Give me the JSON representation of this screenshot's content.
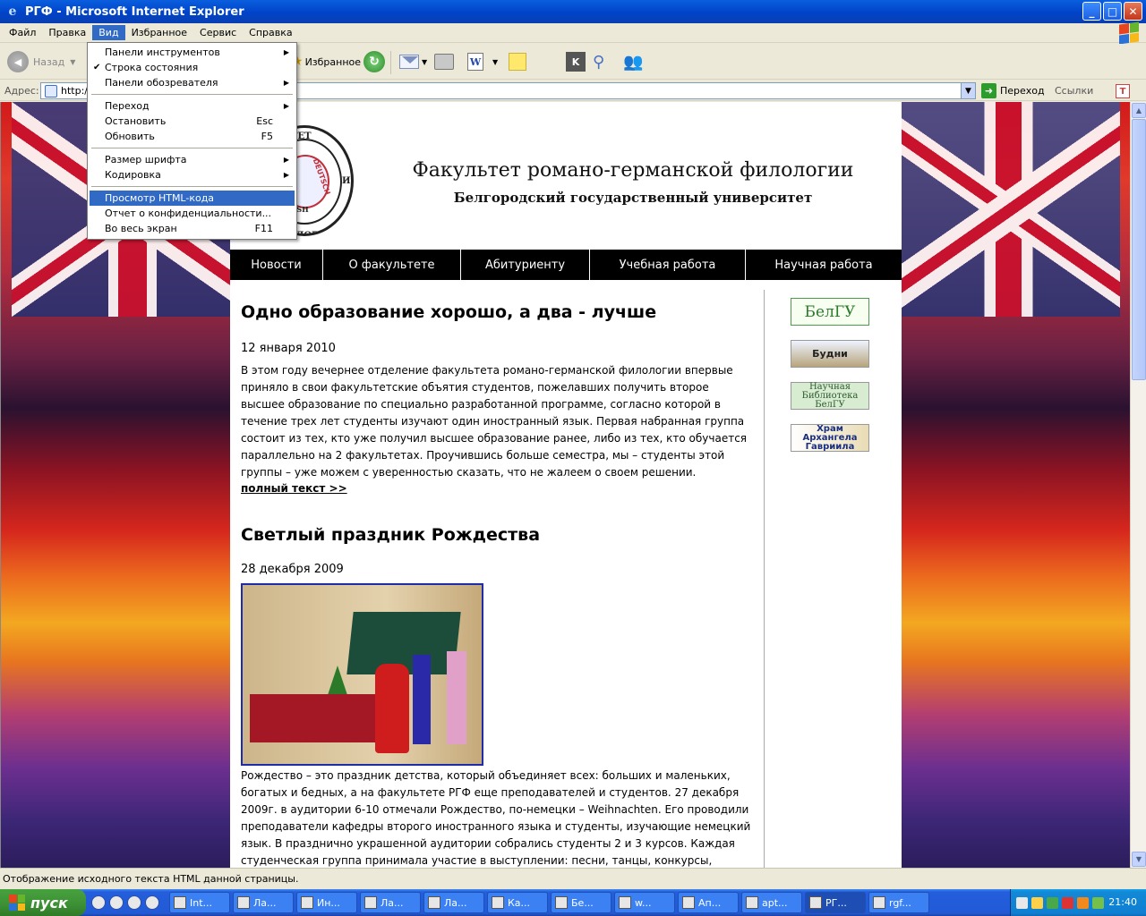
{
  "window": {
    "title": "РГФ - Microsoft Internet Explorer",
    "minimize": "_",
    "maximize": "□",
    "close": "✕"
  },
  "menubar": {
    "items": [
      "Файл",
      "Правка",
      "Вид",
      "Избранное",
      "Сервис",
      "Справка"
    ],
    "active_index": 2
  },
  "toolbar": {
    "back_label": "Назад",
    "favorites_label": "Избранное"
  },
  "address": {
    "label": "Адрес:",
    "value": "http://",
    "go_label": "Переход",
    "links_label": "Ссылки"
  },
  "view_menu": {
    "items": [
      {
        "label": "Панели инструментов",
        "shortcut": "",
        "submenu": true,
        "checked": false
      },
      {
        "label": "Строка состояния",
        "shortcut": "",
        "submenu": false,
        "checked": true
      },
      {
        "label": "Панели обозревателя",
        "shortcut": "",
        "submenu": true,
        "checked": false
      },
      {
        "sep": true
      },
      {
        "label": "Переход",
        "shortcut": "",
        "submenu": true,
        "checked": false
      },
      {
        "label": "Остановить",
        "shortcut": "Esc",
        "submenu": false,
        "checked": false
      },
      {
        "label": "Обновить",
        "shortcut": "F5",
        "submenu": false,
        "checked": false
      },
      {
        "sep": true
      },
      {
        "label": "Размер шрифта",
        "shortcut": "",
        "submenu": true,
        "checked": false
      },
      {
        "label": "Кодировка",
        "shortcut": "",
        "submenu": true,
        "checked": false
      },
      {
        "sep": true
      },
      {
        "label": "Просмотр HTML-кода",
        "shortcut": "",
        "submenu": false,
        "checked": false,
        "highlighted": true
      },
      {
        "label": "Отчет о конфиденциальности...",
        "shortcut": "",
        "submenu": false,
        "checked": false
      },
      {
        "label": "Во весь экран",
        "shortcut": "F11",
        "submenu": false,
        "checked": false
      }
    ]
  },
  "site": {
    "title": "Факультет романо-германской филологии",
    "subtitle": "Белгородский государственный университет",
    "seal": {
      "top": "ЛЬТЕТ",
      "deutsch": "DEUTSCH",
      "english": "LISH",
      "bottom": "СКОЙ ФИЛОЛОГИ",
      "right": "И"
    },
    "nav": [
      "Новости",
      "О факультете",
      "Абитуриенту",
      "Учебная работа",
      "Научная работа"
    ],
    "nav_widths": [
      104,
      154,
      144,
      174,
      174
    ],
    "articles": [
      {
        "title": "Одно образование хорошо, а два - лучше",
        "date": "12 января 2010",
        "text": "В этом году вечернее отделение факультета романо-германской филологии впервые приняло в свои факультетские объятия студентов, пожелавших получить второе высшее образование по специально разработанной программе, согласно которой в течение трех лет студенты изучают один иностранный язык. Первая набранная группа состоит из тех, кто уже получил высшее образование ранее, либо из тех, кто обучается параллельно на 2 факультетах. Проучившись больше семестра, мы – студенты этой группы – уже можем с уверенностью сказать, что не жалеем о своем решении.",
        "more": "полный текст >>"
      },
      {
        "title": "Светлый праздник Рождества",
        "date": "28 декабря 2009",
        "text": "Рождество – это праздник детства, который объединяет всех: больших и маленьких, богатых и бедных, а на факультете РГФ еще преподавателей и студентов. 27 декабря 2009г. в аудитории 6-10 отмечали Рождество, по-немецки – Weihnachten. Его проводили преподаватели кафедры второго иностранного языка и студенты, изучающие немецкий язык. В празднично украшенной аудитории собрались студенты 2 и 3 курсов. Каждая студенческая группа принимала участие в выступлении: песни, танцы, конкурсы, инсценировки на русском и немецком языках, яркие костюмы и веселый"
      }
    ],
    "banners": [
      {
        "id": "belgu",
        "label": "БелГУ"
      },
      {
        "id": "budni",
        "label": "Будни"
      },
      {
        "id": "lib",
        "label": "Научная Библиотека БелГУ"
      },
      {
        "id": "hram",
        "label": "Храм Архангела Гавриила"
      }
    ]
  },
  "statusbar": {
    "text": "Отображение исходного текста HTML данной страницы."
  },
  "taskbar": {
    "start_label": "пуск",
    "tasks": [
      "Int...",
      "Ла...",
      "Ин...",
      "Ла...",
      "Ла...",
      "Ка...",
      "Бе...",
      "w...",
      "Ап...",
      "apt...",
      "РГ...",
      "rgf..."
    ],
    "active_task_index": 10,
    "clock": "21:40"
  }
}
